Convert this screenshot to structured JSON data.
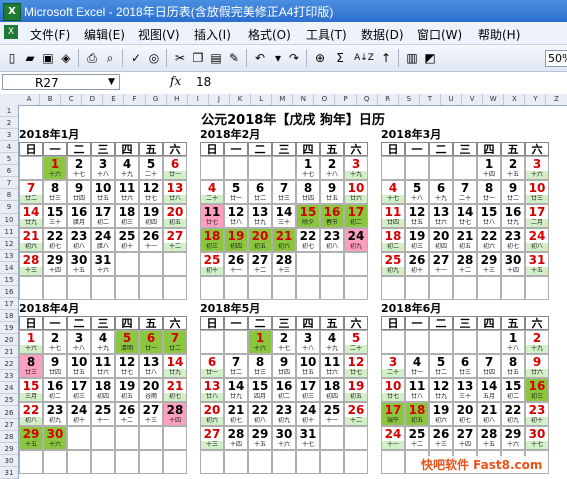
{
  "window": {
    "title": "Microsoft Excel - 2018年日历表(含放假完美修正A4打印版)",
    "app_icon": "excel-icon"
  },
  "menu": [
    "文件(F)",
    "编辑(E)",
    "视图(V)",
    "插入(I)",
    "格式(O)",
    "工具(T)",
    "数据(D)",
    "窗口(W)",
    "帮助(H)"
  ],
  "toolbar": {
    "zoom": "50%",
    "sum_symbol": "Σ",
    "sort_symbol": "A↓Z"
  },
  "formula": {
    "name_box": "R27",
    "fx": "fx",
    "value": "18"
  },
  "columns": [
    "A",
    "B",
    "C",
    "D",
    "E",
    "F",
    "G",
    "H",
    "I",
    "J",
    "K",
    "L",
    "M",
    "N",
    "O",
    "P",
    "Q",
    "R",
    "S",
    "T",
    "U",
    "V",
    "W",
    "X",
    "Y",
    "Z"
  ],
  "rows": [
    "1",
    "2",
    "3",
    "4",
    "5",
    "6",
    "7",
    "8",
    "9",
    "10",
    "11",
    "12",
    "13",
    "14",
    "15",
    "16",
    "17",
    "18",
    "19",
    "20",
    "21",
    "22",
    "23",
    "24",
    "25",
    "26",
    "27",
    "28",
    "29",
    "30",
    "31"
  ],
  "calendar_title": "公元2018年【戊戌  狗年】日历",
  "weekdays": [
    "日",
    "一",
    "二",
    "三",
    "四",
    "五",
    "六"
  ],
  "months": [
    {
      "title": "2018年1月",
      "start": 1,
      "days": 31,
      "lunar": [
        "",
        "十六",
        "十七",
        "十八",
        "十九",
        "二十",
        "廿一",
        "廿二",
        "廿三",
        "廿四",
        "廿五",
        "廿六",
        "廿七",
        "廿八",
        "廿九",
        "三十",
        "腊月",
        "初二",
        "初三",
        "初四",
        "初五",
        "初六",
        "初七",
        "初八",
        "腊八",
        "初十",
        "十一",
        "十二",
        "十三",
        "十四",
        "十五",
        "十六"
      ],
      "holiday": [
        1
      ],
      "workday": []
    },
    {
      "title": "2018年2月",
      "start": 4,
      "days": 28,
      "lunar": [
        "",
        "十七",
        "十八",
        "十九",
        "二十",
        "廿一",
        "廿二",
        "廿三",
        "廿四",
        "廿五",
        "廿六",
        "廿七",
        "廿八",
        "廿九",
        "三十",
        "除夕",
        "春节",
        "初二",
        "初三",
        "初四",
        "初五",
        "初六",
        "初七",
        "初八",
        "初九",
        "初十",
        "十一",
        "十二",
        "十三"
      ],
      "holiday": [
        15,
        16,
        17,
        18,
        19,
        20,
        21
      ],
      "workday": [
        11,
        24
      ]
    },
    {
      "title": "2018年3月",
      "start": 4,
      "days": 31,
      "lunar": [
        "",
        "十四",
        "十五",
        "十六",
        "十七",
        "十八",
        "十九",
        "二十",
        "廿一",
        "廿二",
        "廿三",
        "廿四",
        "廿五",
        "廿六",
        "廿七",
        "廿八",
        "廿九",
        "二月",
        "初二",
        "初三",
        "初四",
        "初五",
        "初六",
        "初七",
        "初八",
        "初九",
        "初十",
        "十一",
        "十二",
        "十三",
        "十四",
        "十五"
      ],
      "holiday": [],
      "workday": []
    },
    {
      "title": "2018年4月",
      "start": 0,
      "days": 30,
      "lunar": [
        "",
        "十六",
        "十七",
        "十八",
        "十九",
        "清明",
        "廿一",
        "廿二",
        "廿三",
        "廿四",
        "廿五",
        "廿六",
        "廿七",
        "廿八",
        "廿九",
        "三月",
        "初二",
        "初三",
        "初四",
        "初五",
        "谷雨",
        "初七",
        "初八",
        "初九",
        "初十",
        "十一",
        "十二",
        "十三",
        "十四",
        "十五",
        "十六"
      ],
      "holiday": [
        5,
        6,
        7,
        29,
        30
      ],
      "workday": [
        8,
        28
      ]
    },
    {
      "title": "2018年5月",
      "start": 2,
      "days": 31,
      "lunar": [
        "",
        "十六",
        "十七",
        "十八",
        "十九",
        "二十",
        "廿一",
        "廿二",
        "廿三",
        "廿四",
        "廿五",
        "廿六",
        "廿七",
        "廿八",
        "廿九",
        "四月",
        "初二",
        "初三",
        "初四",
        "初五",
        "初六",
        "初七",
        "初八",
        "初九",
        "初十",
        "十一",
        "十二",
        "十三",
        "十四",
        "十五",
        "十六",
        "十七"
      ],
      "holiday": [
        1
      ],
      "workday": []
    },
    {
      "title": "2018年6月",
      "start": 5,
      "days": 30,
      "lunar": [
        "",
        "十八",
        "十九",
        "二十",
        "廿一",
        "廿二",
        "廿三",
        "廿四",
        "廿五",
        "廿六",
        "廿七",
        "廿八",
        "廿九",
        "三十",
        "五月",
        "初二",
        "初三",
        "端午",
        "初五",
        "初六",
        "初七",
        "初八",
        "初九",
        "初十",
        "十一",
        "十二",
        "十三",
        "十四",
        "十五",
        "十六",
        "十七"
      ],
      "holiday": [
        16,
        17,
        18
      ],
      "workday": []
    }
  ],
  "watermark": "快吧软件 Fast8.com"
}
